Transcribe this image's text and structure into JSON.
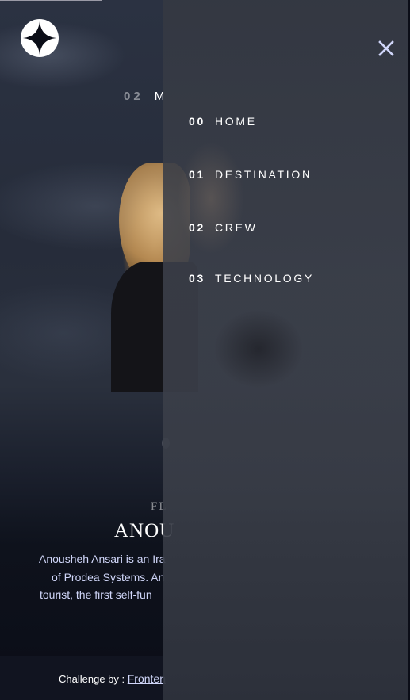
{
  "page": {
    "subtitle_number": "02",
    "subtitle_text": "M",
    "role": "FL",
    "name": "ANOU",
    "bio_lines": [
      "Anousheh Ansari is an Ira",
      "of Prodea Systems. An",
      "tourist, the first self-fun"
    ]
  },
  "nav": {
    "items": [
      {
        "number": "00",
        "label": "HOME"
      },
      {
        "number": "01",
        "label": "DESTINATION"
      },
      {
        "number": "02",
        "label": "CREW"
      },
      {
        "number": "03",
        "label": "TECHNOLOGY"
      }
    ]
  },
  "footer": {
    "prefix": "Challenge by :",
    "link": "Fronten"
  },
  "icons": {
    "logo": "star-logo-icon",
    "close": "close-icon"
  },
  "colors": {
    "background": "#0b0d17",
    "accent_text": "#d0d6f9",
    "close_icon": "#d0d6f9"
  }
}
